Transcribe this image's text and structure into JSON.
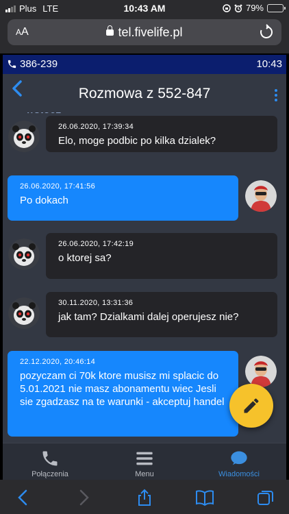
{
  "status_bar": {
    "carrier": "Plus",
    "network": "LTE",
    "time": "10:43 AM",
    "battery_percent": "79%",
    "battery_level": 0.79
  },
  "browser": {
    "text_size_label": "AA",
    "url": "tel.fivelife.pl"
  },
  "app_bar": {
    "phone_number": "386-239",
    "clock": "10:43"
  },
  "conversation": {
    "back_label": "wstecz",
    "title": "Rozmowa z 552-847"
  },
  "messages": [
    {
      "direction": "incoming",
      "timestamp": "26.06.2020, 17:39:34",
      "text": "Elo, moge podbic po kilka dzialek?"
    },
    {
      "direction": "outgoing",
      "timestamp": "26.06.2020, 17:41:56",
      "text": "Po dokach"
    },
    {
      "direction": "incoming",
      "timestamp": "26.06.2020, 17:42:19",
      "text": "o ktorej sa?"
    },
    {
      "direction": "incoming",
      "timestamp": "30.11.2020, 13:31:36",
      "text": "jak tam? Dzialkami dalej operujesz nie?"
    },
    {
      "direction": "outgoing",
      "timestamp": "22.12.2020, 20:46:14",
      "text": "pozyczam ci 70k ktore musisz mi splacic do 5.01.2021 nie masz abonamentu wiec Jesli sie zgadzasz na te warunki - akceptuj handel"
    }
  ],
  "bottom_nav": [
    {
      "label": "Połączenia",
      "icon": "phone-icon"
    },
    {
      "label": "Menu",
      "icon": "hamburger-icon"
    },
    {
      "label": "Wiadomości",
      "icon": "chat-bubble-icon",
      "active": true
    }
  ],
  "colors": {
    "app_background": "#333843",
    "top_bar": "#0b1e6e",
    "incoming_bubble": "#242428",
    "outgoing_bubble": "#1687fd",
    "fab": "#f6c22b",
    "active_nav": "#3b8fe0"
  }
}
